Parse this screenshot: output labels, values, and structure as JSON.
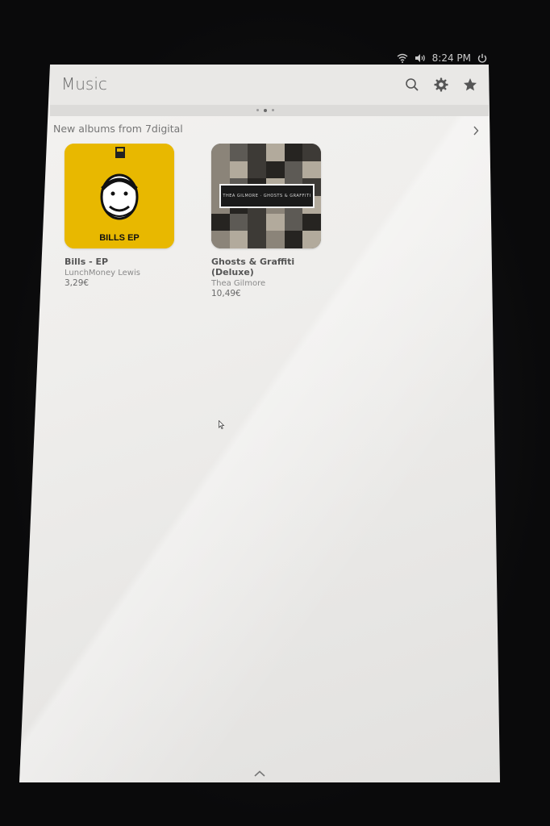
{
  "status": {
    "time": "8:24 PM",
    "icons": [
      "wifi-icon",
      "volume-icon",
      "power-icon"
    ]
  },
  "header": {
    "title": "Music",
    "icons": [
      "search-icon",
      "gear-icon",
      "star-icon"
    ]
  },
  "section": {
    "title": "New albums from 7digital"
  },
  "albums": [
    {
      "title": "Bills - EP",
      "artist": "LunchMoney Lewis",
      "price": "3,29€",
      "cover_text": "BILLS EP",
      "cover_color": "#e8b800"
    },
    {
      "title": "Ghosts & Graffiti (Deluxe)",
      "artist": "Thea Gilmore",
      "price": "10,49€",
      "cover_text": "THEA GILMORE · GHOSTS & GRAFFITI"
    }
  ],
  "colors": {
    "accent_edge": "#d96b3a",
    "header_bg": "#e9e8e6",
    "screen_bg": "#f0efed"
  }
}
